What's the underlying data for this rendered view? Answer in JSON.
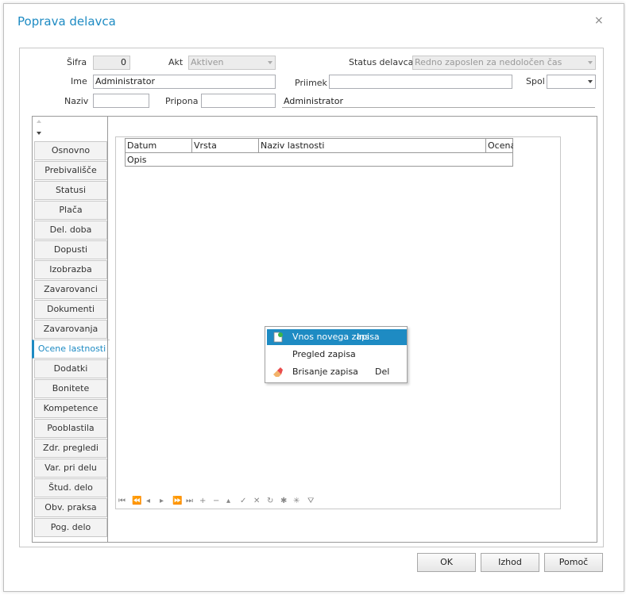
{
  "dialog": {
    "title": "Poprava delavca",
    "close_glyph": "×"
  },
  "form": {
    "sifra_label": "Šifra",
    "sifra_value": "0",
    "akt_label": "Akt",
    "akt_value": "Aktiven",
    "status_label": "Status delavca",
    "status_value": "Redno zaposlen za nedoločen čas",
    "ime_label": "Ime",
    "ime_value": "Administrator",
    "priimek_label": "Priimek",
    "priimek_value": "",
    "spol_label": "Spol",
    "spol_value": "",
    "naziv_label": "Naziv",
    "naziv_value": "",
    "pripona_label": "Pripona",
    "pripona_value": "",
    "display_name": "Administrator"
  },
  "tabs": [
    {
      "label": "Osnovno"
    },
    {
      "label": "Prebivališče"
    },
    {
      "label": "Statusi"
    },
    {
      "label": "Plača"
    },
    {
      "label": "Del. doba"
    },
    {
      "label": "Dopusti"
    },
    {
      "label": "Izobrazba"
    },
    {
      "label": "Zavarovanci"
    },
    {
      "label": "Dokumenti"
    },
    {
      "label": "Zavarovanja"
    },
    {
      "label": "Ocene lastnosti"
    },
    {
      "label": "Dodatki"
    },
    {
      "label": "Bonitete"
    },
    {
      "label": "Kompetence"
    },
    {
      "label": "Pooblastila"
    },
    {
      "label": "Zdr. pregledi"
    },
    {
      "label": "Var. pri delu"
    },
    {
      "label": "Štud. delo"
    },
    {
      "label": "Obv. praksa"
    },
    {
      "label": "Pog. delo"
    }
  ],
  "active_tab": "Ocene lastnosti",
  "grid": {
    "columns": [
      "Datum",
      "Vrsta",
      "Naziv lastnosti",
      "Ocena"
    ],
    "row2": "Opis"
  },
  "context_menu": {
    "items": [
      {
        "label": "Vnos novega zapisa",
        "shortcut": "Ins",
        "icon": "new-record-icon"
      },
      {
        "label": "Pregled zapisa",
        "shortcut": "",
        "icon": ""
      },
      {
        "label": "Brisanje zapisa",
        "shortcut": "Del",
        "icon": "eraser-icon"
      }
    ]
  },
  "buttons": {
    "ok": "OK",
    "izhod": "Izhod",
    "pomoc": "Pomoč"
  },
  "colors": {
    "accent": "#1e8bc3"
  }
}
